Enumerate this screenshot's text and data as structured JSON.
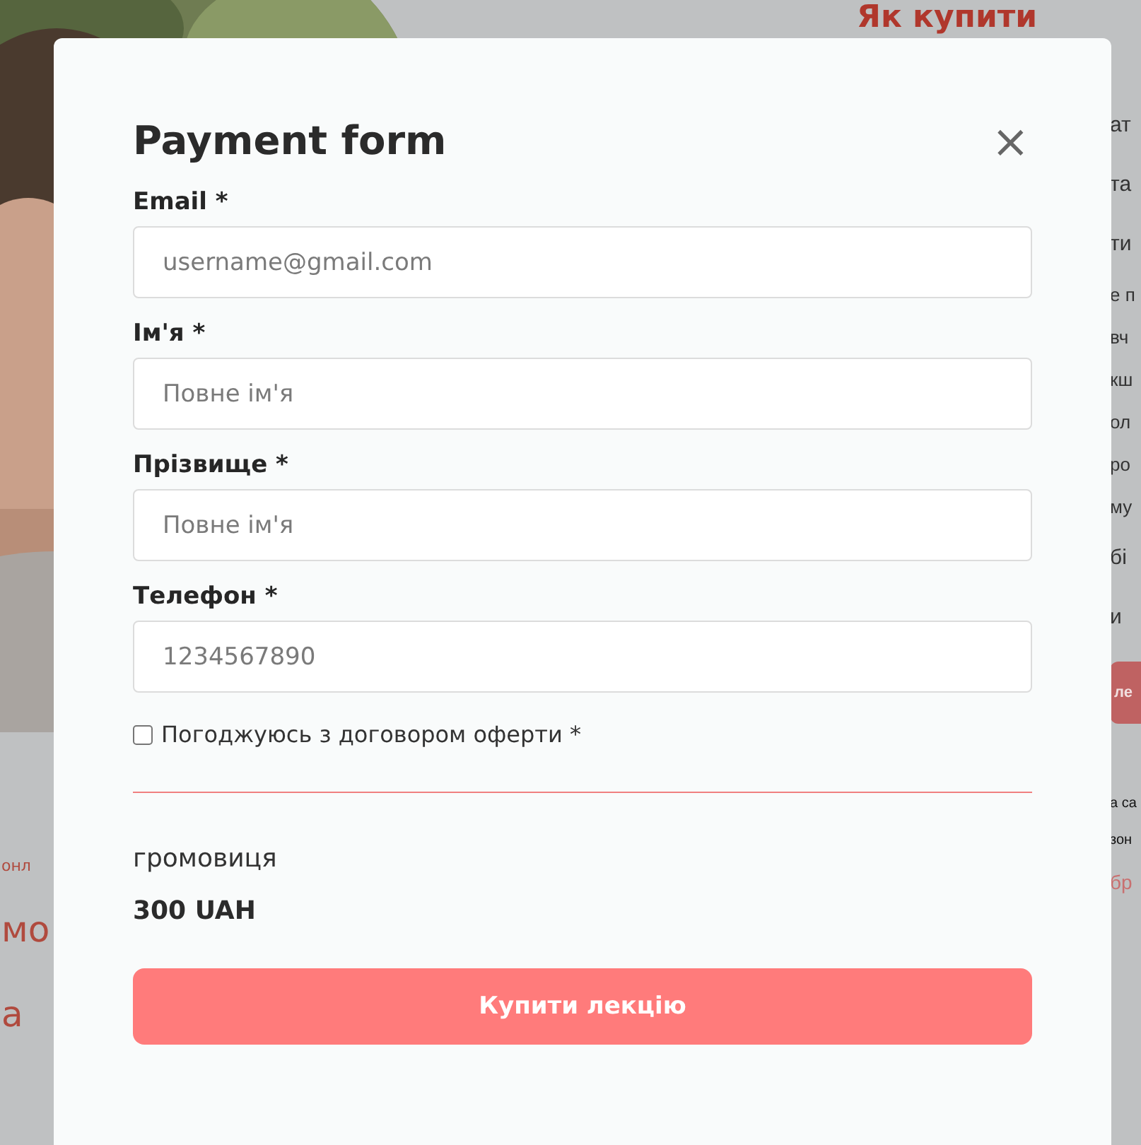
{
  "background": {
    "heading": "Як купити",
    "lines": [
      {
        "text": "ат",
        "kind": "para"
      },
      {
        "text": "та",
        "kind": "para"
      },
      {
        "text": "ти",
        "kind": "para"
      },
      {
        "text": "е п",
        "kind": "dense"
      },
      {
        "text": "вч",
        "kind": "dense"
      },
      {
        "text": "кш",
        "kind": "dense"
      },
      {
        "text": "ол",
        "kind": "dense"
      },
      {
        "text": "ро",
        "kind": "dense"
      },
      {
        "text": "му",
        "kind": "dense"
      },
      {
        "text": "бі",
        "kind": "para"
      },
      {
        "text": "и",
        "kind": "para"
      }
    ],
    "button": "ле",
    "notes": [
      "а са",
      "зон"
    ],
    "link": "бр",
    "left_texts": [
      {
        "text": "онл",
        "kind": "small"
      },
      {
        "text": "мо",
        "kind": "large"
      },
      {
        "text": "а",
        "kind": "large"
      }
    ]
  },
  "dialog": {
    "title": "Payment form",
    "close": "×",
    "fields": [
      {
        "label": "Email *",
        "placeholder": "username@gmail.com"
      },
      {
        "label": "Ім'я *",
        "placeholder": "Повне ім'я"
      },
      {
        "label": "Прізвище *",
        "placeholder": "Повне ім'я"
      },
      {
        "label": "Телефон *",
        "placeholder": "1234567890"
      }
    ],
    "agree": {
      "label": "Погоджуюсь з договором оферти *",
      "checked": false
    },
    "product": "громовиця",
    "price": "300 UAH",
    "buy_button": "Купити лекцію"
  }
}
